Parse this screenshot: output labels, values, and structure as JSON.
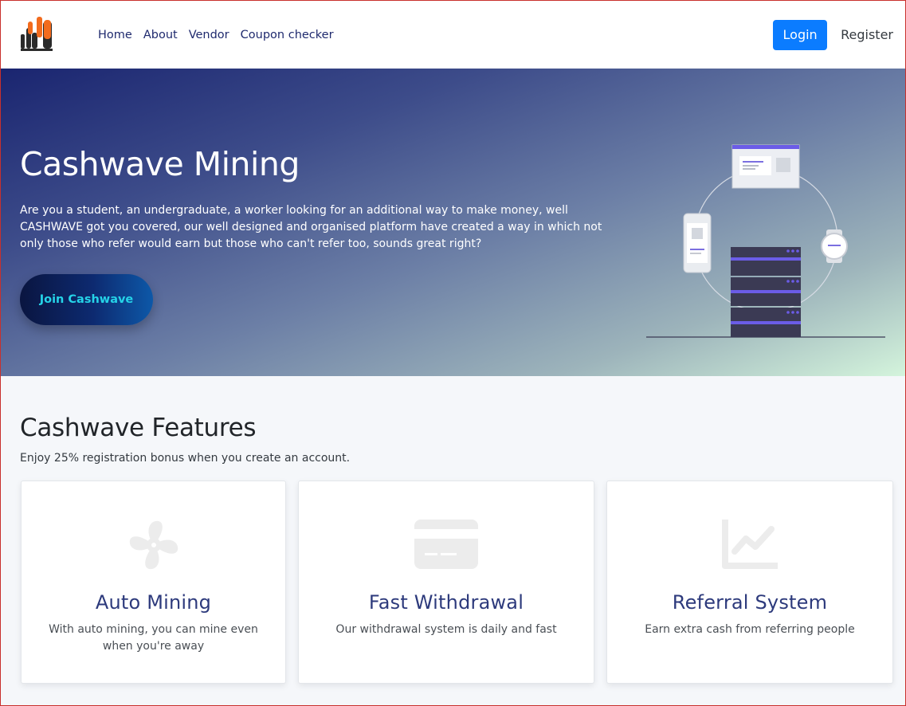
{
  "nav": {
    "logo_icon": "cashwave-logo-icon",
    "links": [
      "Home",
      "About",
      "Vendor",
      "Coupon checker"
    ],
    "login_label": "Login",
    "register_label": "Register"
  },
  "hero": {
    "title": "Cashwave Mining",
    "text": "Are you a student, an undergraduate, a worker looking for an additional way to make money, well CASHWAVE got you covered, our well designed and organised platform have created a way in which not only those who refer would earn but those who can't refer too, sounds great right?",
    "cta_label": "Join Cashwave",
    "illustration_icon": "server-devices-illustration"
  },
  "features": {
    "title": "Cashwave Features",
    "subtitle": "Enjoy 25% registration bonus when you create an account.",
    "cards": [
      {
        "icon": "fan-icon",
        "title": "Auto Mining",
        "desc": "With auto mining, you can mine even when you're away"
      },
      {
        "icon": "credit-card-icon",
        "title": "Fast Withdrawal",
        "desc": "Our withdrawal system is daily and fast"
      },
      {
        "icon": "chart-line-icon",
        "title": "Referral System",
        "desc": "Earn extra cash from referring people"
      }
    ]
  },
  "colors": {
    "primary": "#0b7cff",
    "nav_link": "#1f2a6e",
    "card_title": "#2d3a7c",
    "cta_text": "#25d3e8",
    "logo_orange": "#f26b1d"
  }
}
